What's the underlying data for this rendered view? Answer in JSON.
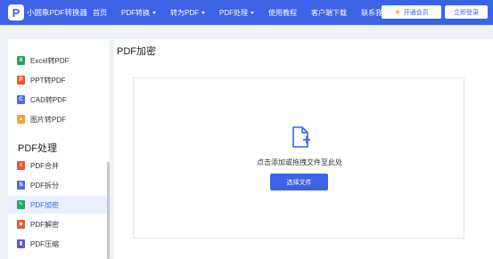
{
  "header": {
    "logo_letter": "P",
    "app_title": "小圆象PDF转换器",
    "nav": [
      {
        "label": "首页",
        "dropdown": false
      },
      {
        "label": "PDF转换",
        "dropdown": true
      },
      {
        "label": "转为PDF",
        "dropdown": true
      },
      {
        "label": "PDF处理",
        "dropdown": true
      },
      {
        "label": "使用教程",
        "dropdown": false
      },
      {
        "label": "客户端下载",
        "dropdown": false
      },
      {
        "label": "联系我们",
        "dropdown": false
      }
    ],
    "vip_label": "开通会员",
    "login_label": "立即登录"
  },
  "sidebar": {
    "convert_items": [
      {
        "label": "Excel转PDF",
        "icon": "excel-file-icon",
        "color": "#22a565",
        "glyph": "X"
      },
      {
        "label": "PPT转PDF",
        "icon": "ppt-file-icon",
        "color": "#e8582f",
        "glyph": "P"
      },
      {
        "label": "CAD转PDF",
        "icon": "cad-file-icon",
        "color": "#4f6be3",
        "glyph": "C"
      },
      {
        "label": "图片转PDF",
        "icon": "image-file-icon",
        "color": "#f0a32f",
        "glyph": "▲"
      }
    ],
    "section_title": "PDF处理",
    "process_items": [
      {
        "label": "PDF合并",
        "icon": "merge-icon",
        "color": "#e8582f",
        "glyph": "≡",
        "active": false
      },
      {
        "label": "PDF拆分",
        "icon": "split-icon",
        "color": "#4f6be3",
        "glyph": "⇅",
        "active": false
      },
      {
        "label": "PDF加密",
        "icon": "encrypt-icon",
        "color": "#22a565",
        "glyph": "✎",
        "active": true
      },
      {
        "label": "PDF解密",
        "icon": "decrypt-icon",
        "color": "#e8582f",
        "glyph": "◆",
        "active": false
      },
      {
        "label": "PDF压缩",
        "icon": "compress-icon",
        "color": "#5b59d6",
        "glyph": "▮",
        "active": false
      }
    ]
  },
  "main": {
    "title": "PDF加密",
    "drop_text": "点击添加或拖拽文件至此处",
    "select_button": "选择文件"
  },
  "colors": {
    "accent": "#3c63e6",
    "active_bg": "#eaf0ff"
  }
}
